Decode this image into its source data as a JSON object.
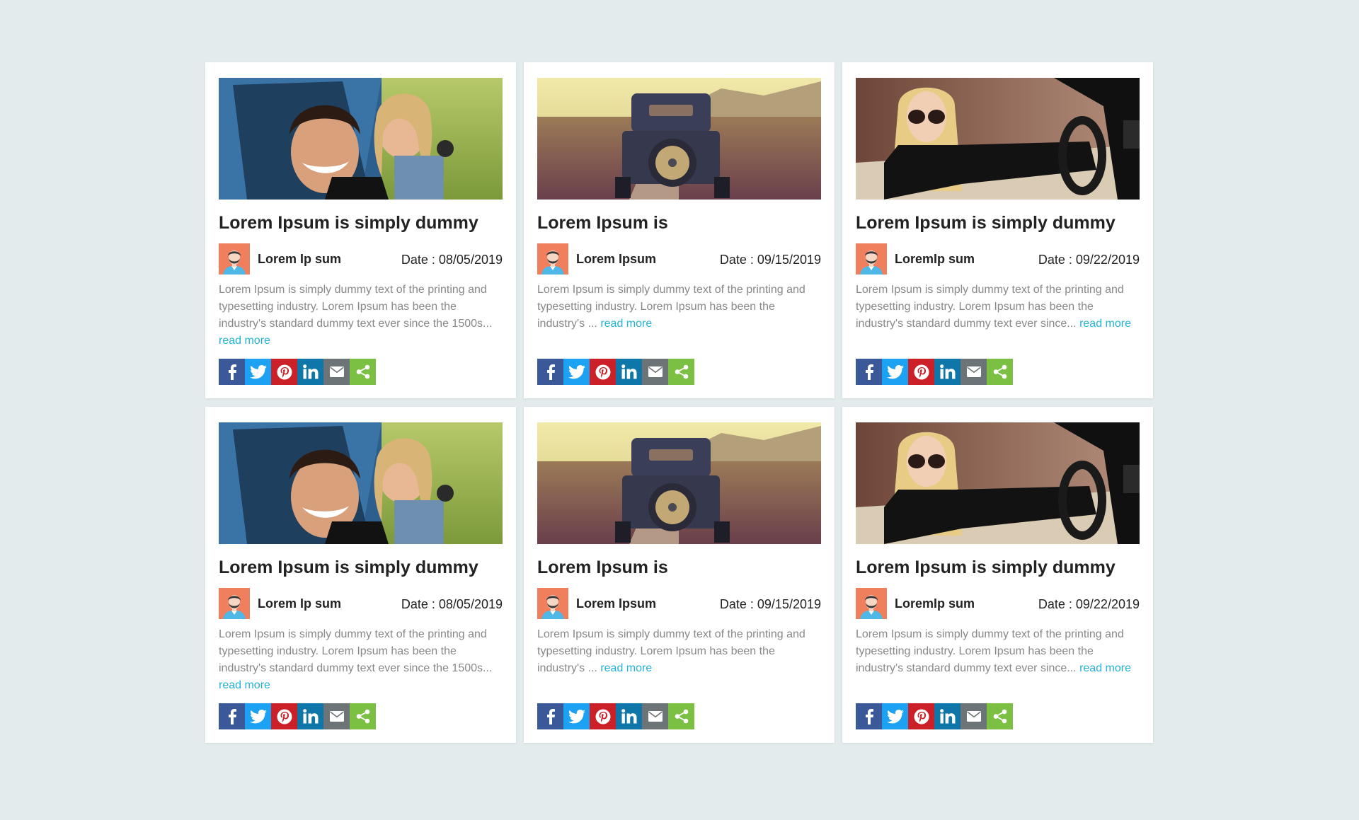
{
  "read_more_label": "read more",
  "share_buttons": [
    {
      "icon": "facebook-icon",
      "color": "#3b5998"
    },
    {
      "icon": "twitter-icon",
      "color": "#1da1f2"
    },
    {
      "icon": "pinterest-icon",
      "color": "#cb2027"
    },
    {
      "icon": "linkedin-icon",
      "color": "#0e76a8"
    },
    {
      "icon": "email-icon",
      "color": "#6d7478"
    },
    {
      "icon": "share-icon",
      "color": "#7bc043"
    }
  ],
  "cards": [
    {
      "image": "couple-in-car-with-keys",
      "title": "Lorem Ipsum is simply dummy",
      "author": "Lorem Ip sum",
      "date": "Date : 08/05/2019",
      "excerpt": "Lorem Ipsum is simply dummy text of the printing and typesetting industry. Lorem Ipsum has been the industry's standard dummy text ever since the 1500s...",
      "read_more": "read more"
    },
    {
      "image": "vintage-car-on-road",
      "title": "Lorem Ipsum is",
      "author": "Lorem Ipsum",
      "date": "Date : 09/15/2019",
      "excerpt": "Lorem Ipsum is simply dummy text of the printing and typesetting industry. Lorem Ipsum has been the industry's ...",
      "read_more": "read more"
    },
    {
      "image": "woman-driving-convertible",
      "title": "Lorem Ipsum is simply dummy",
      "author": "LoremIp sum",
      "date": "Date : 09/22/2019",
      "excerpt": "Lorem Ipsum is simply dummy text of the printing and typesetting industry. Lorem Ipsum has been the industry's standard dummy text ever since...",
      "read_more": "read more"
    },
    {
      "image": "couple-in-car-with-keys",
      "title": "Lorem Ipsum is simply dummy",
      "author": "Lorem Ip sum",
      "date": "Date : 08/05/2019",
      "excerpt": "Lorem Ipsum is simply dummy text of the printing and typesetting industry. Lorem Ipsum has been the industry's standard dummy text ever since the 1500s...",
      "read_more": "read more"
    },
    {
      "image": "vintage-car-on-road",
      "title": "Lorem Ipsum is",
      "author": "Lorem Ipsum",
      "date": "Date : 09/15/2019",
      "excerpt": "Lorem Ipsum is simply dummy text of the printing and typesetting industry. Lorem Ipsum has been the industry's ...",
      "read_more": "read more"
    },
    {
      "image": "woman-driving-convertible",
      "title": "Lorem Ipsum is simply dummy",
      "author": "LoremIp sum",
      "date": "Date : 09/22/2019",
      "excerpt": "Lorem Ipsum is simply dummy text of the printing and typesetting industry. Lorem Ipsum has been the industry's standard dummy text ever since...",
      "read_more": "read more"
    }
  ]
}
